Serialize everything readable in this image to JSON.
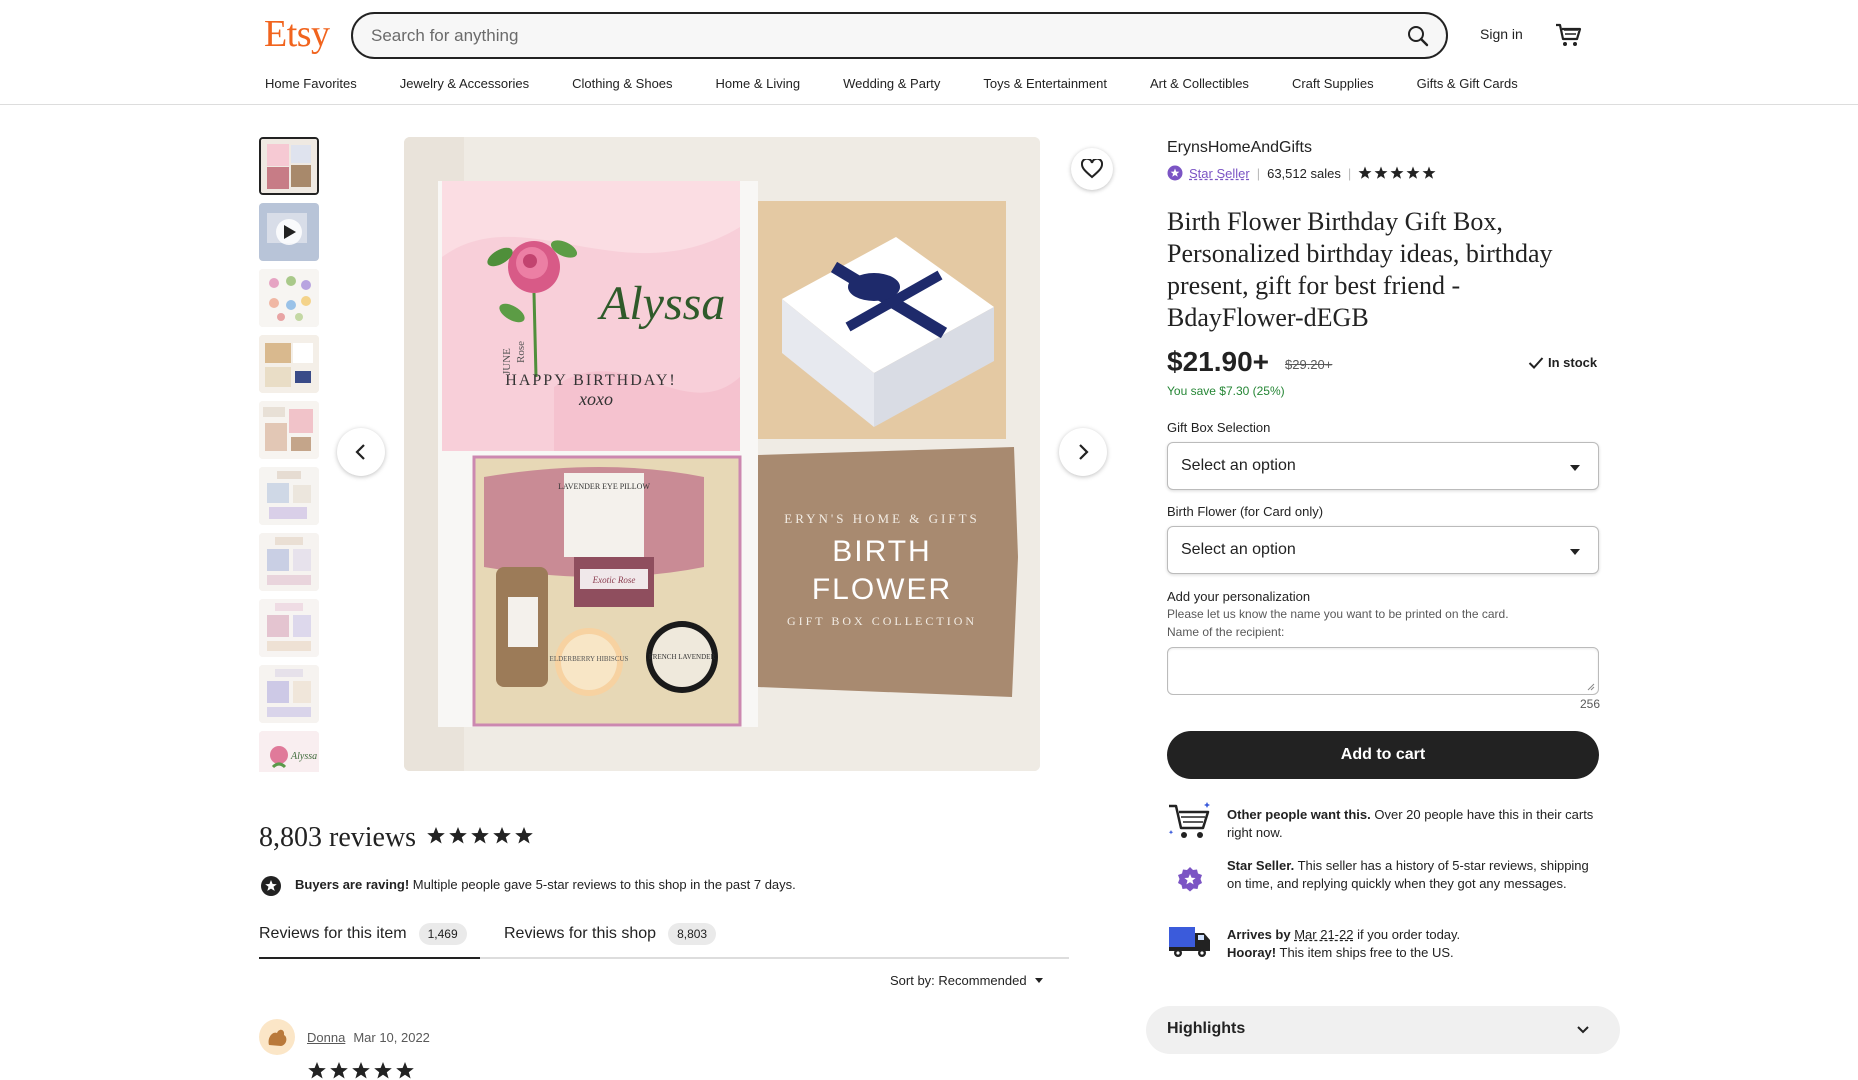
{
  "header": {
    "logo": "Etsy",
    "search_placeholder": "Search for anything",
    "signin": "Sign in",
    "nav": [
      "Home Favorites",
      "Jewelry & Accessories",
      "Clothing & Shoes",
      "Home & Living",
      "Wedding & Party",
      "Toys & Entertainment",
      "Art & Collectibles",
      "Craft Supplies",
      "Gifts & Gift Cards"
    ]
  },
  "gallery": {
    "image_text": {
      "card_name": "Alyssa",
      "card_month": "JUNE",
      "card_flower": "Rose",
      "card_greeting": "HAPPY BIRTHDAY!",
      "card_sign": "xoxo",
      "pillow_label": "LAVENDER EYE PILLOW",
      "soap_label": "Exotic Rose",
      "candle_1": "ELDERBERRY HIBISCUS",
      "candle_2": "FRENCH LAVENDER",
      "brand": "ERYN'S HOME & GIFTS",
      "collection_title_1": "BIRTH",
      "collection_title_2": "FLOWER",
      "collection_subtitle": "GIFT BOX COLLECTION"
    }
  },
  "listing": {
    "shop_name": "ErynsHomeAndGifts",
    "star_seller": "Star Seller",
    "sales": "63,512 sales",
    "title": "Birth Flower Birthday Gift Box, Personalized birthday ideas, birthday present, gift for best friend - BdayFlower-dEGB",
    "price": "$21.90+",
    "original_price": "$29.20+",
    "in_stock": "In stock",
    "savings": "You save $7.30 (25%)",
    "option1_label": "Gift Box Selection",
    "option1_value": "Select an option",
    "option2_label": "Birth Flower (for Card only)",
    "option2_value": "Select an option",
    "personalization_label": "Add your personalization",
    "personalization_hint": "Please let us know the name you want to be printed on the card.",
    "personalization_hint2": "Name of the recipient:",
    "char_count": "256",
    "add_to_cart": "Add to cart",
    "info": {
      "demand_bold": "Other people want this.",
      "demand_text": " Over 20 people have this in their carts right now.",
      "star_bold": "Star Seller.",
      "star_text": " This seller has a history of 5-star reviews, shipping on time, and replying quickly when they got any messages.",
      "arrives_bold": "Arrives by",
      "arrives_date": "Mar 21-22",
      "arrives_text": " if you order today.",
      "hooray_bold": "Hooray!",
      "hooray_text": " This item ships free to the US."
    },
    "highlights": "Highlights"
  },
  "reviews": {
    "count_label": "8,803 reviews",
    "raving_bold": "Buyers are raving!",
    "raving_text": " Multiple people gave 5-star reviews to this shop in the past 7 days.",
    "tab_item": "Reviews for this item",
    "tab_item_count": "1,469",
    "tab_shop": "Reviews for this shop",
    "tab_shop_count": "8,803",
    "sort": "Sort by: Recommended",
    "first": {
      "name": "Donna",
      "date": "Mar 10, 2022"
    }
  },
  "colors": {
    "brand": "#f1641e",
    "star_seller": "#7b54c4",
    "savings": "#258635"
  }
}
